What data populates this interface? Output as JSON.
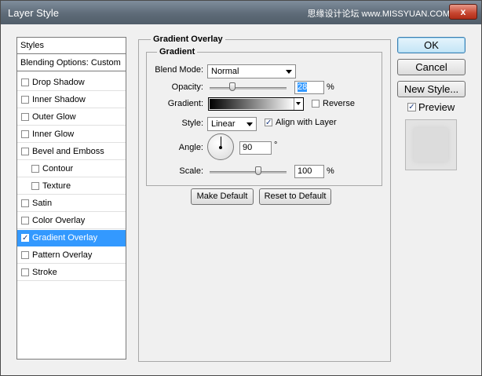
{
  "window": {
    "title": "Layer Style",
    "watermark": "思缘设计论坛 www.MISSYUAN.COM",
    "close_label": "x"
  },
  "styles_panel": {
    "header": "Styles",
    "blending": "Blending Options: Custom",
    "items": [
      {
        "label": "Drop Shadow",
        "checked": false
      },
      {
        "label": "Inner Shadow",
        "checked": false
      },
      {
        "label": "Outer Glow",
        "checked": false
      },
      {
        "label": "Inner Glow",
        "checked": false
      },
      {
        "label": "Bevel and Emboss",
        "checked": false
      },
      {
        "label": "Contour",
        "checked": false
      },
      {
        "label": "Texture",
        "checked": false
      },
      {
        "label": "Satin",
        "checked": false
      },
      {
        "label": "Color Overlay",
        "checked": false
      },
      {
        "label": "Gradient Overlay",
        "checked": true
      },
      {
        "label": "Pattern Overlay",
        "checked": false
      },
      {
        "label": "Stroke",
        "checked": false
      }
    ]
  },
  "gradient_overlay": {
    "section_title": "Gradient Overlay",
    "group_title": "Gradient",
    "blend_mode_label": "Blend Mode:",
    "blend_mode_value": "Normal",
    "opacity_label": "Opacity:",
    "opacity_value": "28",
    "opacity_unit": "%",
    "gradient_label": "Gradient:",
    "reverse_label": "Reverse",
    "style_label": "Style:",
    "style_value": "Linear",
    "align_label": "Align with Layer",
    "angle_label": "Angle:",
    "angle_value": "90",
    "angle_unit": "°",
    "scale_label": "Scale:",
    "scale_value": "100",
    "scale_unit": "%",
    "make_default": "Make Default",
    "reset_default": "Reset to Default"
  },
  "buttons": {
    "ok": "OK",
    "cancel": "Cancel",
    "new_style": "New Style...",
    "preview_label": "Preview"
  },
  "check_mark": "✓"
}
